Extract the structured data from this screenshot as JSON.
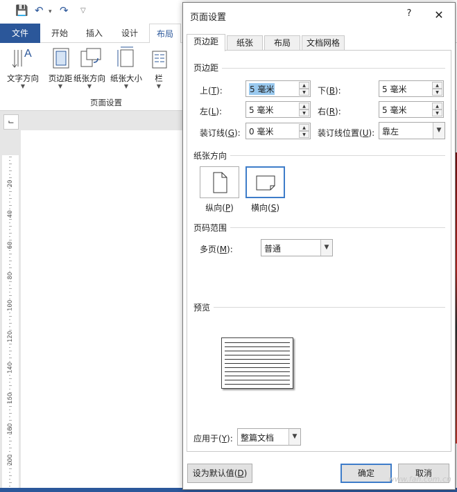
{
  "word": {
    "tabs": {
      "file": "文件",
      "home": "开始",
      "insert": "插入",
      "design": "设计",
      "layout": "布局"
    },
    "ribbon": {
      "text_direction": "文字方向",
      "margins": "页边距",
      "orientation": "纸张方向",
      "size": "纸张大小",
      "columns": "栏",
      "group_label": "页面设置"
    },
    "ruler_numbers": [
      "20",
      "40",
      "60",
      "80",
      "100",
      "120",
      "140",
      "160",
      "180",
      "200"
    ]
  },
  "dialog": {
    "title": "页面设置",
    "help": "?",
    "close": "✕",
    "tabs": [
      "页边距",
      "纸张",
      "布局",
      "文档网格"
    ],
    "margins_section": "页边距",
    "top": {
      "label": "上(",
      "key": "T",
      "end": "):",
      "value": "5 毫米"
    },
    "bottom": {
      "label": "下(",
      "key": "B",
      "end": "):",
      "value": "5 毫米"
    },
    "left": {
      "label": "左(",
      "key": "L",
      "end": "):",
      "value": "5 毫米"
    },
    "right": {
      "label": "右(",
      "key": "R",
      "end": "):",
      "value": "5 毫米"
    },
    "gutter": {
      "label": "装订线(",
      "key": "G",
      "end": "):",
      "value": "0 毫米"
    },
    "gutter_pos": {
      "label": "装订线位置(",
      "key": "U",
      "end": "):",
      "value": "靠左"
    },
    "orientation_section": "纸张方向",
    "portrait": {
      "label": "纵向(",
      "key": "P",
      "end": ")"
    },
    "landscape": {
      "label": "横向(",
      "key": "S",
      "end": ")"
    },
    "pages_section": "页码范围",
    "multiple_pages": {
      "label": "多页(",
      "key": "M",
      "end": "):",
      "value": "普通"
    },
    "preview_section": "预览",
    "apply_to": {
      "label": "应用于(",
      "key": "Y",
      "end": "):",
      "value": "整篇文档"
    },
    "default_button": {
      "label": "设为默认值(",
      "key": "D",
      "end": ")"
    },
    "ok": "确定",
    "cancel": "取消"
  },
  "watermark": "www.fan.com.cn"
}
